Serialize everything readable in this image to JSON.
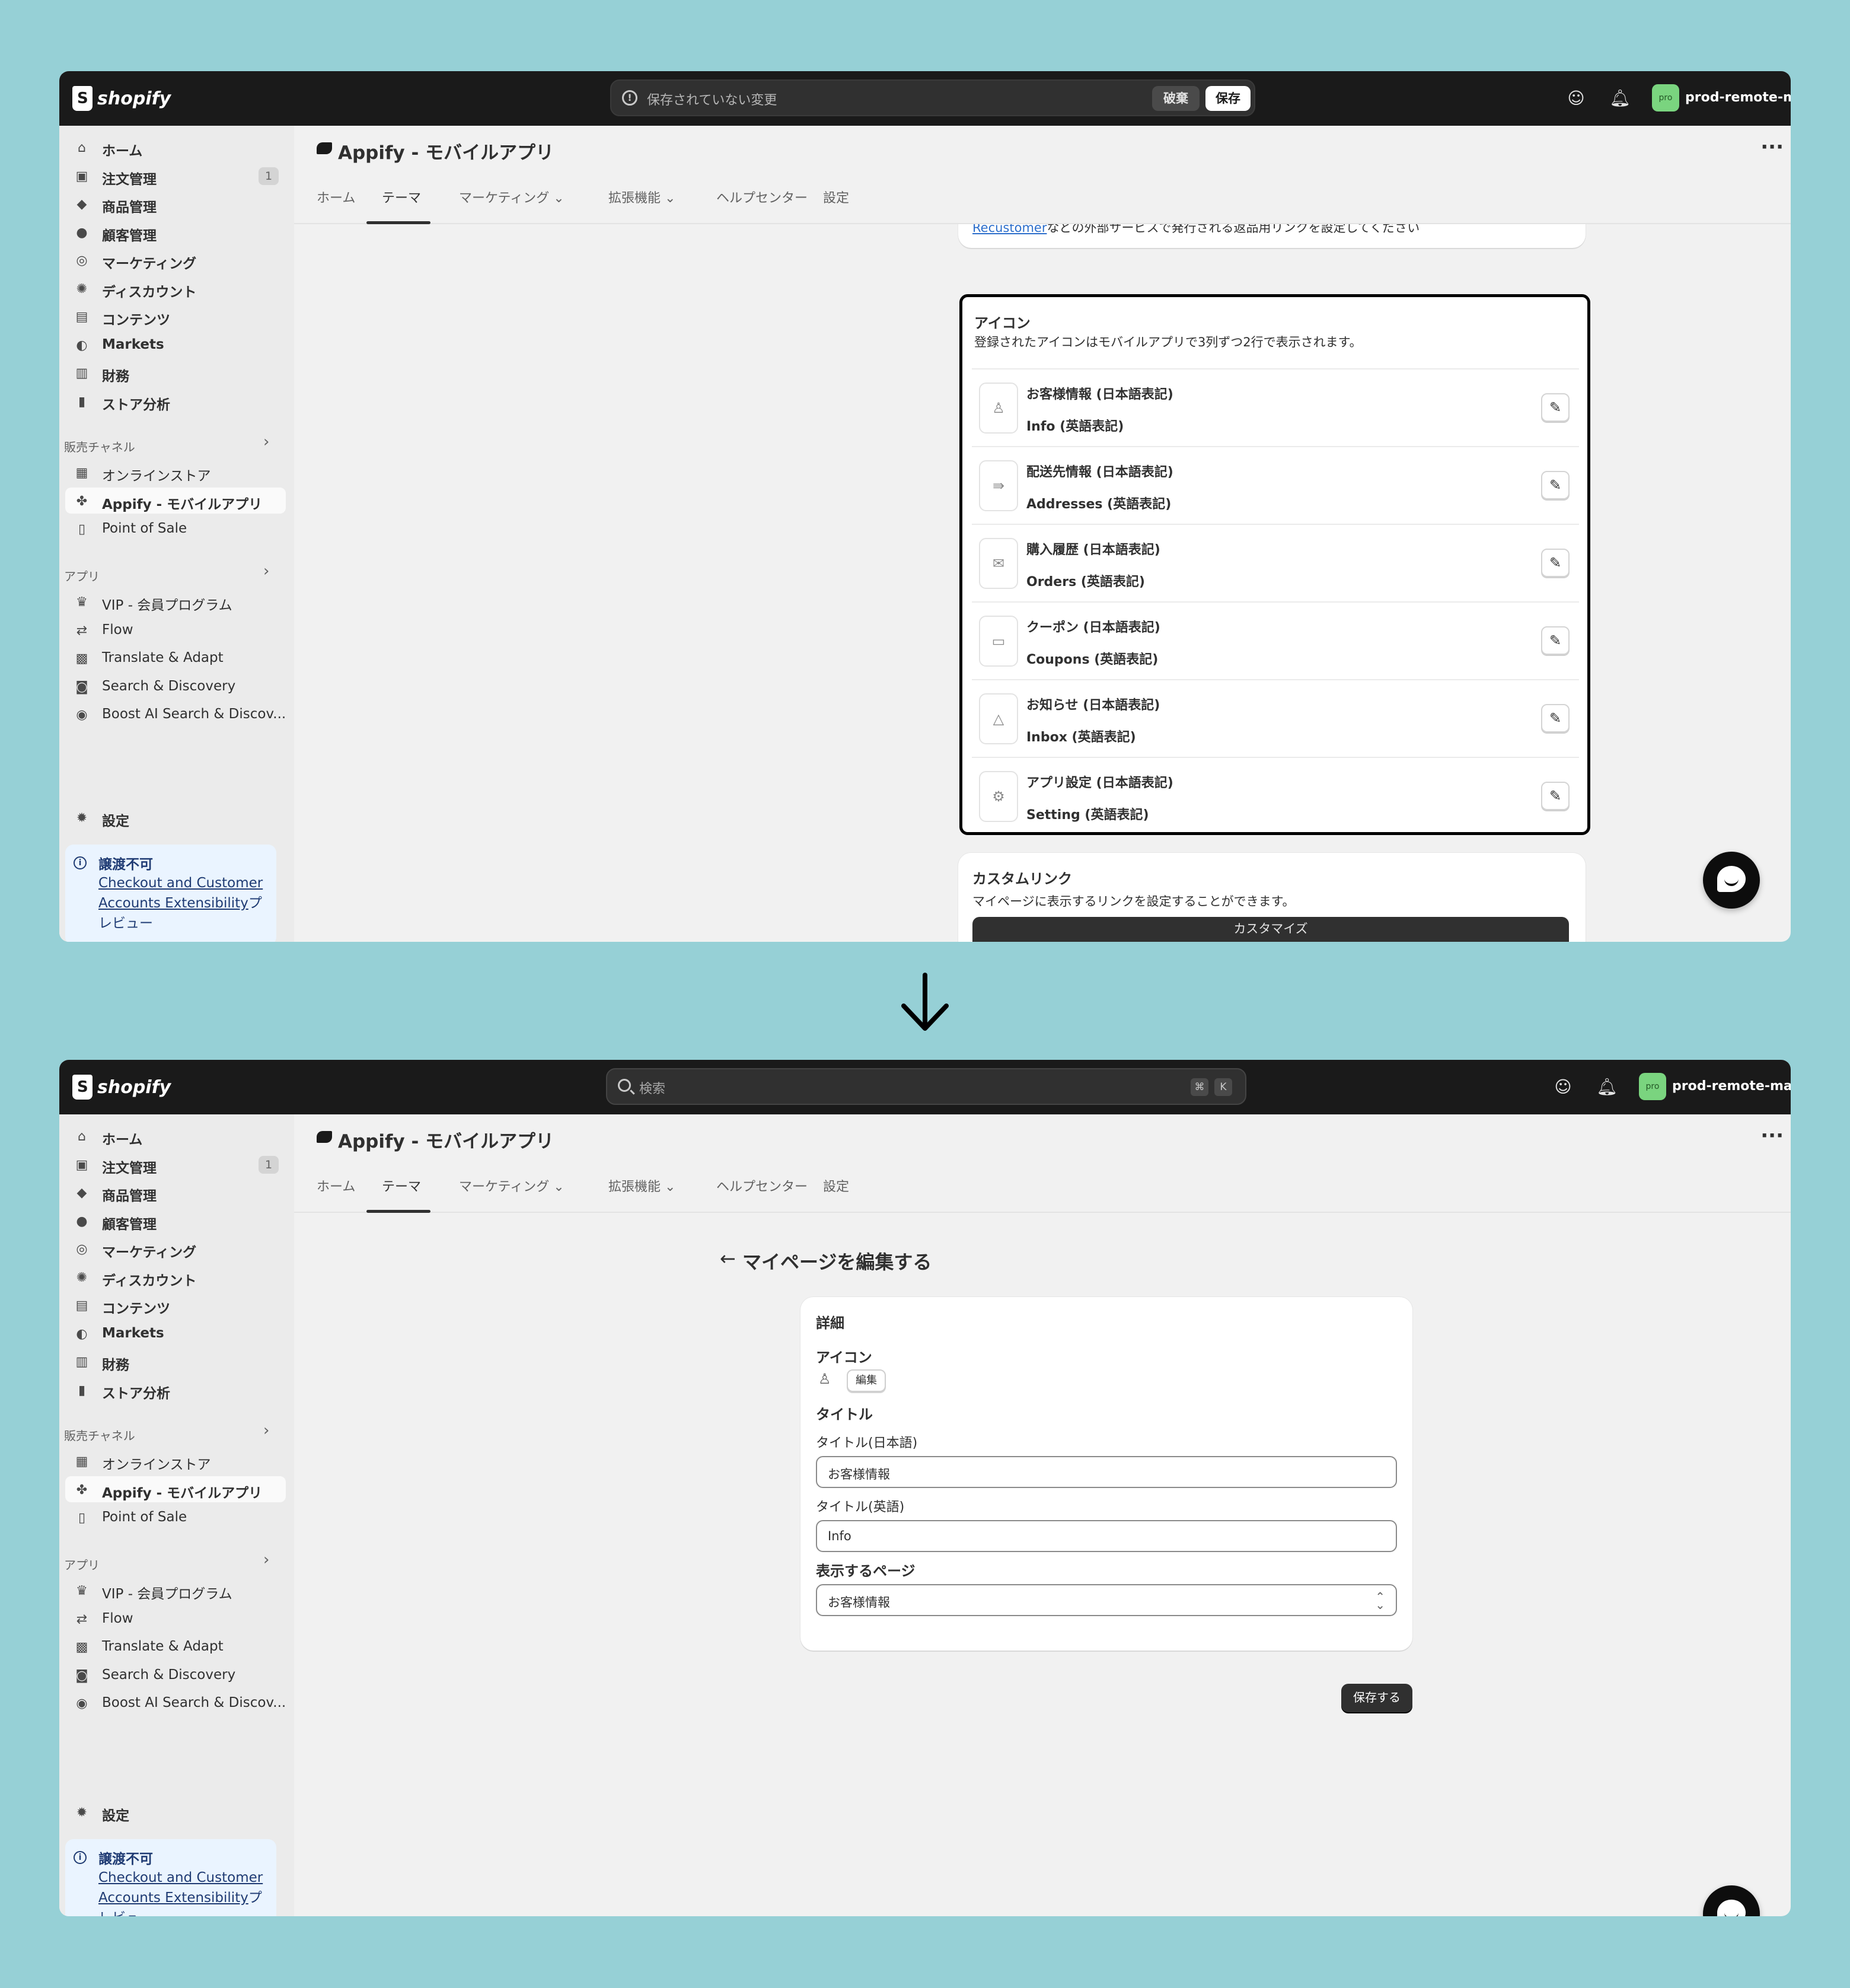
{
  "brand": {
    "logo_text": "shopify",
    "store_name": "prod-remote-marry",
    "store_avatar": "pro"
  },
  "screen1": {
    "unsaved": {
      "text": "保存されていない変更",
      "discard": "破棄",
      "save": "保存"
    },
    "store_name_cut": "prod-remote-marr",
    "partial_card": {
      "link": "Recustomer",
      "text": "などの外部サービスで発行される返品用リンクを設定してください"
    },
    "icons_card": {
      "title": "アイコン",
      "subtitle": "登録されたアイコンはモバイルアプリで3列ずつ2行で表示されます。",
      "rows": [
        {
          "jp": "お客様情報 (日本語表記)",
          "en": "Info (英語表記)",
          "icon": "person-icon"
        },
        {
          "jp": "配送先情報 (日本語表記)",
          "en": "Addresses (英語表記)",
          "icon": "truck-icon"
        },
        {
          "jp": "購入履歴 (日本語表記)",
          "en": "Orders (英語表記)",
          "icon": "inbox-check-icon"
        },
        {
          "jp": "クーポン (日本語表記)",
          "en": "Coupons (英語表記)",
          "icon": "coupon-icon"
        },
        {
          "jp": "お知らせ (日本語表記)",
          "en": "Inbox (英語表記)",
          "icon": "bell-icon"
        },
        {
          "jp": "アプリ設定 (日本語表記)",
          "en": "Setting (英語表記)",
          "icon": "gear-icon"
        }
      ]
    },
    "custom_link_card": {
      "title": "カスタムリンク",
      "subtitle": "マイページに表示するリンクを設定することができます。",
      "button": "カスタマイズ"
    }
  },
  "screen2": {
    "search": {
      "placeholder": "検索",
      "kbd1": "⌘",
      "kbd2": "K"
    },
    "page_title": "マイページを編集する",
    "form": {
      "section_title": "詳細",
      "icon_label": "アイコン",
      "icon_edit": "編集",
      "title_label": "タイトル",
      "title_jp_label": "タイトル(日本語)",
      "title_jp_value": "お客様情報",
      "title_en_label": "タイトル(英語)",
      "title_en_value": "Info",
      "page_label": "表示するページ",
      "page_value": "お客様情報"
    },
    "save_button": "保存する"
  },
  "app": {
    "title": "Appify - モバイルアプリ",
    "more": "···"
  },
  "tabs": [
    {
      "label": "ホーム"
    },
    {
      "label": "テーマ",
      "active": true
    },
    {
      "label": "マーケティング"
    },
    {
      "label": "拡張機能"
    },
    {
      "label": "ヘルプセンター"
    },
    {
      "label": "設定"
    }
  ],
  "sidebar": {
    "main": [
      {
        "label": "ホーム",
        "icon": "home-icon"
      },
      {
        "label": "注文管理",
        "icon": "inbox-icon",
        "badge": "1"
      },
      {
        "label": "商品管理",
        "icon": "tag-icon"
      },
      {
        "label": "顧客管理",
        "icon": "person-icon"
      },
      {
        "label": "マーケティング",
        "icon": "target-icon"
      },
      {
        "label": "ディスカウント",
        "icon": "discount-icon"
      },
      {
        "label": "コンテンツ",
        "icon": "content-icon"
      },
      {
        "label": "Markets",
        "icon": "globe-icon"
      },
      {
        "label": "財務",
        "icon": "bank-icon"
      },
      {
        "label": "ストア分析",
        "icon": "chart-icon"
      }
    ],
    "sales_channels_label": "販売チャネル",
    "sales_channels": [
      {
        "label": "オンラインストア",
        "icon": "store-icon"
      },
      {
        "label": "Appify - モバイルアプリ",
        "icon": "appify-icon",
        "active": true
      },
      {
        "label": "Point of Sale",
        "icon": "pos-icon"
      }
    ],
    "apps_label": "アプリ",
    "apps": [
      {
        "label": "VIP - 会員プログラム",
        "icon": "crown-icon"
      },
      {
        "label": "Flow",
        "icon": "flow-icon"
      },
      {
        "label": "Translate & Adapt",
        "icon": "translate-icon"
      },
      {
        "label": "Search & Discovery",
        "icon": "search-discovery-icon"
      },
      {
        "label": "Boost AI Search & Discov...",
        "icon": "boost-icon"
      }
    ],
    "settings": "設定",
    "notice": {
      "title": "譲渡不可",
      "link": "Checkout and Customer Accounts Extensibility",
      "suffix": "プレビュー"
    }
  }
}
